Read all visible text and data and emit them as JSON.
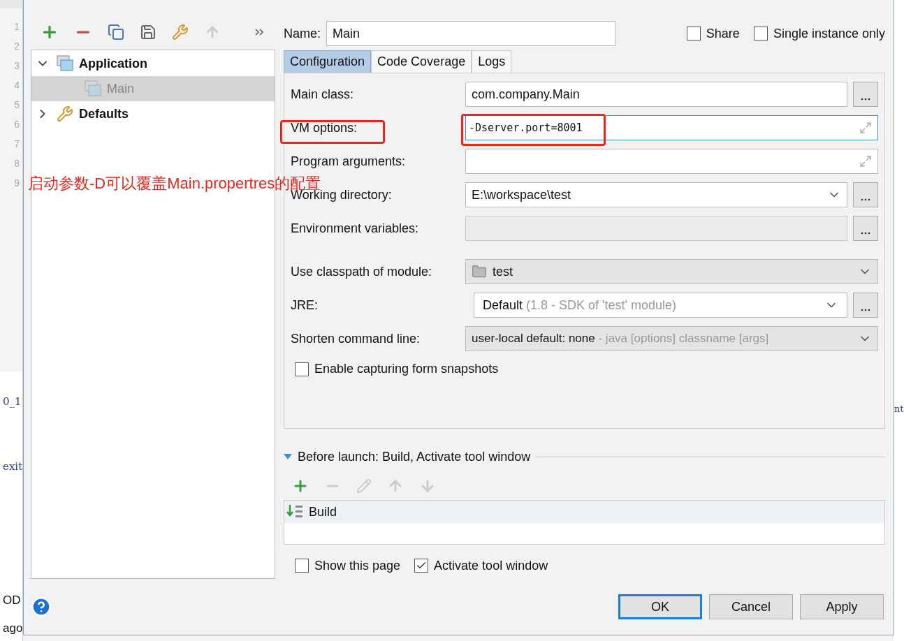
{
  "editor_background": {
    "line_numbers": [
      "1",
      "2",
      "3",
      "4",
      "5",
      "6",
      "7",
      "8",
      "9"
    ],
    "fragments_left": [
      "0_1",
      "exit",
      "OD",
      "ago"
    ],
    "fragment_right": "nt"
  },
  "tree": [
    {
      "label": "Application",
      "expanded": true,
      "children": [
        {
          "label": "Main",
          "selected": true
        }
      ]
    },
    {
      "label": "Defaults",
      "expanded": false
    }
  ],
  "name": {
    "label": "Name:",
    "value": "Main"
  },
  "share": {
    "label": "Share",
    "checked": false
  },
  "single_instance": {
    "label": "Single instance only",
    "checked": false
  },
  "tabs": [
    {
      "label": "Configuration",
      "selected": true
    },
    {
      "label": "Code Coverage",
      "selected": false
    },
    {
      "label": "Logs",
      "selected": false
    }
  ],
  "fields": [
    {
      "kind": "text",
      "label": "Main class:",
      "value": "com.company.Main",
      "browse": true
    },
    {
      "kind": "expand",
      "label": "VM options:",
      "value": "-Dserver.port=8001",
      "focused": true
    },
    {
      "kind": "expand",
      "label": "Program arguments:",
      "focused": false
    },
    {
      "kind": "combo",
      "label": "Working directory:",
      "value": "E:\\workspace\\test",
      "browse": true
    },
    {
      "kind": "readonly",
      "label": "Environment variables:",
      "browse": true
    }
  ],
  "module": {
    "label": "Use classpath of module:",
    "value": "test"
  },
  "jre": {
    "label": "JRE:",
    "value": "Default",
    "detail": "(1.8 - SDK of 'test' module)"
  },
  "shorten": {
    "label": "Shorten command line:",
    "value": "user-local default: none",
    "detail": "- java [options] classname [args]"
  },
  "capture": {
    "label": "Enable capturing form snapshots",
    "checked": false
  },
  "before_launch": {
    "title": "Before launch: Build, Activate tool window",
    "expanded": true,
    "tasks": [
      {
        "label": "Build",
        "selected": true
      }
    ]
  },
  "show_page": {
    "label": "Show this page",
    "checked": false
  },
  "activate": {
    "label": "Activate tool window",
    "checked": true
  },
  "buttons": [
    {
      "label": "OK",
      "default": true
    },
    {
      "label": "Cancel",
      "default": false
    },
    {
      "label": "Apply",
      "default": false
    }
  ],
  "annotation": {
    "text": "启动参数-D可以覆盖Main.propertres的配置"
  }
}
